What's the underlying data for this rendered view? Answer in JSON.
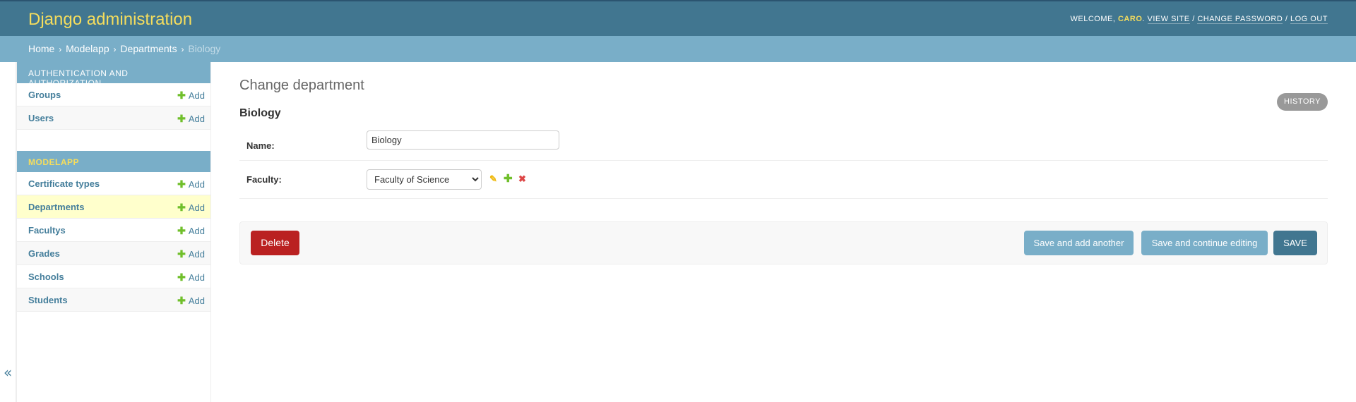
{
  "header": {
    "brand": "Django administration",
    "welcome": "Welcome,",
    "username": "caro",
    "view_site": "View site",
    "change_password": "Change password",
    "log_out": "Log out",
    "separator": "/"
  },
  "breadcrumbs": {
    "home": "Home",
    "app": "Modelapp",
    "model": "Departments",
    "current": "Biology",
    "arrow": "›"
  },
  "sidebar": {
    "auth_caption": "Authentication and Authorization",
    "auth_models": [
      {
        "name": "Groups",
        "add": "Add"
      },
      {
        "name": "Users",
        "add": "Add"
      }
    ],
    "app_caption": "Modelapp",
    "app_models": [
      {
        "name": "Certificate types",
        "add": "Add"
      },
      {
        "name": "Departments",
        "add": "Add"
      },
      {
        "name": "Facultys",
        "add": "Add"
      },
      {
        "name": "Grades",
        "add": "Add"
      },
      {
        "name": "Schools",
        "add": "Add"
      },
      {
        "name": "Students",
        "add": "Add"
      }
    ],
    "toggle": "«"
  },
  "content": {
    "title": "Change department",
    "subtitle": "Biology",
    "history": "History",
    "name_label": "Name:",
    "name_value": "Biology",
    "faculty_label": "Faculty:",
    "faculty_selected": "Faculty of Science",
    "delete": "Delete",
    "save_add_another": "Save and add another",
    "save_continue": "Save and continue editing",
    "save": "Save"
  },
  "colors": {
    "header_bg": "#417690",
    "brand": "#f5dd5d",
    "breadcrumb_bg": "#79aec8",
    "link": "#447e9b",
    "delete": "#ba2121",
    "highlight_row": "#ffffcc"
  },
  "icons": {
    "plus": "plus-icon",
    "edit": "pencil-icon",
    "add_related": "plus-icon",
    "delete_related": "x-icon"
  }
}
